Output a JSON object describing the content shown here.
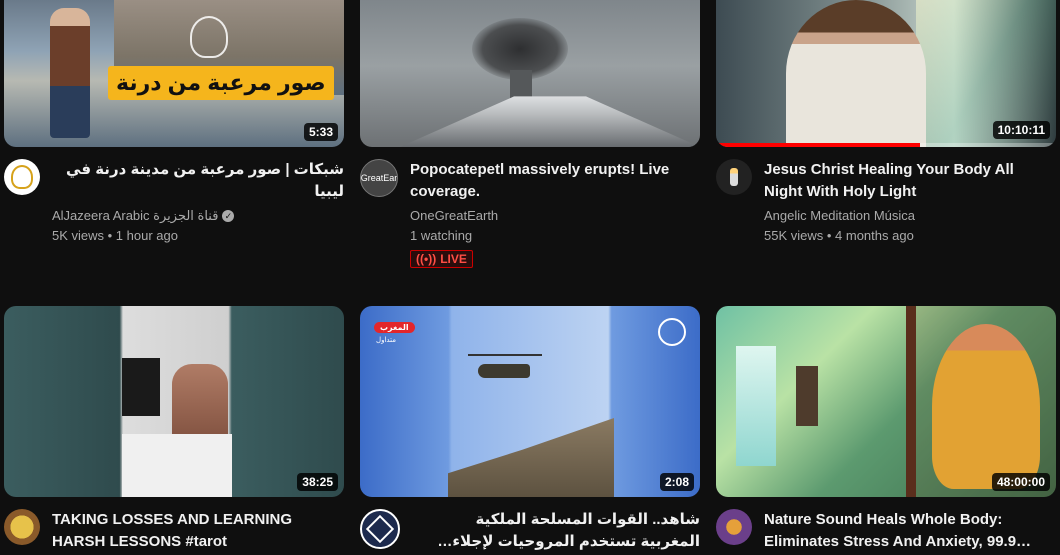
{
  "videos": [
    {
      "title": "شبكات | صور مرعبة من مدينة درنة في ليبيا",
      "thumb_caption": "صور مرعبة من درنة",
      "channel": "AlJazeera Arabic قناة الجزيرة",
      "stats": "5K views • 1 hour ago",
      "duration": "5:33",
      "rtl": true,
      "verified": true
    },
    {
      "title": "Popocatepetl massively erupts! Live coverage.",
      "channel": "OneGreatEarth",
      "stats": "1 watching",
      "avatar_text": "GreatEar",
      "live_label": "LIVE",
      "rtl": false
    },
    {
      "title": "Jesus Christ Healing Your Body All Night With Holy Light",
      "channel": "Angelic Meditation Música",
      "stats": "55K views • 4 months ago",
      "duration": "10:10:11",
      "watch_progress": 0.6,
      "rtl": false
    },
    {
      "title": "TAKING LOSSES AND LEARNING HARSH LESSONS #tarot",
      "channel": "",
      "stats": "",
      "duration": "38:25",
      "rtl": false
    },
    {
      "title": "شاهد.. القوات المسلحة الملكية المغربية تستخدم المروحيات لإجلاء المصابين",
      "channel": "",
      "stats": "",
      "duration": "2:08",
      "thumb_badge": "المغرب",
      "thumb_badge_sub": "متداول",
      "rtl": true
    },
    {
      "title": "Nature Sound Heals Whole Body: Eliminates Stress And Anxiety, 99.9…",
      "channel": "",
      "stats": "",
      "duration": "48:00:00",
      "rtl": false
    }
  ],
  "colors": {
    "background": "#0f0f0f",
    "live_red": "#cc0000",
    "progress_red": "#ff0000"
  }
}
